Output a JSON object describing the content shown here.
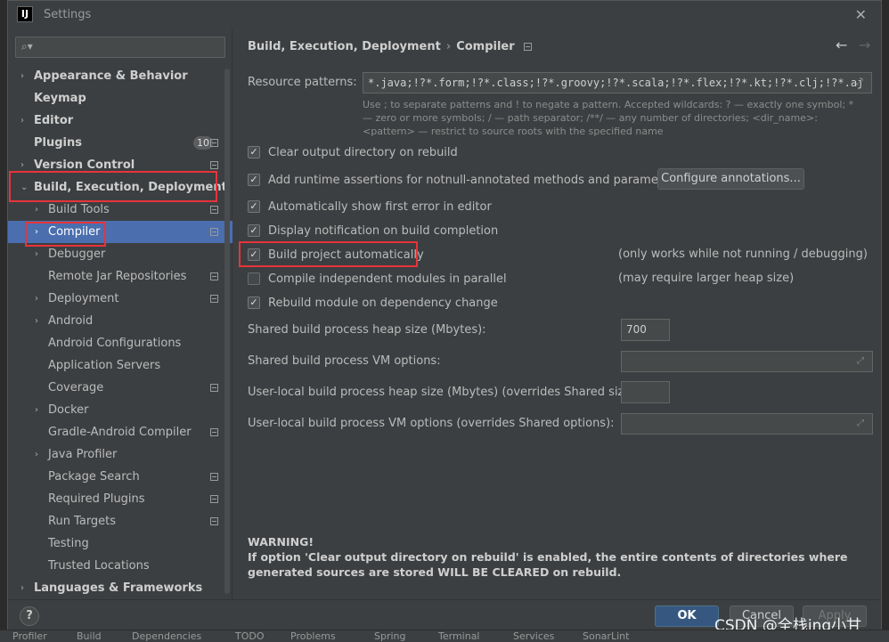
{
  "window": {
    "title": "Settings",
    "app_icon": "IJ"
  },
  "search": {
    "placeholder": ""
  },
  "sidebar": {
    "items": [
      {
        "label": "Appearance & Behavior",
        "arrow": "›",
        "bold": true,
        "badge": "",
        "proj": false,
        "sel": false,
        "level": 0
      },
      {
        "label": "Keymap",
        "arrow": "",
        "bold": true,
        "badge": "",
        "proj": false,
        "sel": false,
        "level": 0
      },
      {
        "label": "Editor",
        "arrow": "›",
        "bold": true,
        "badge": "",
        "proj": false,
        "sel": false,
        "level": 0
      },
      {
        "label": "Plugins",
        "arrow": "",
        "bold": true,
        "badge": "10",
        "proj": true,
        "sel": false,
        "level": 0
      },
      {
        "label": "Version Control",
        "arrow": "›",
        "bold": true,
        "badge": "",
        "proj": true,
        "sel": false,
        "level": 0
      },
      {
        "label": "Build, Execution, Deployment",
        "arrow": "⌄",
        "bold": true,
        "badge": "",
        "proj": false,
        "sel": false,
        "level": 0
      },
      {
        "label": "Build Tools",
        "arrow": "›",
        "bold": false,
        "badge": "",
        "proj": true,
        "sel": false,
        "level": 1
      },
      {
        "label": "Compiler",
        "arrow": "›",
        "bold": false,
        "badge": "",
        "proj": true,
        "sel": true,
        "level": 1
      },
      {
        "label": "Debugger",
        "arrow": "›",
        "bold": false,
        "badge": "",
        "proj": false,
        "sel": false,
        "level": 1
      },
      {
        "label": "Remote Jar Repositories",
        "arrow": "",
        "bold": false,
        "badge": "",
        "proj": true,
        "sel": false,
        "level": 1
      },
      {
        "label": "Deployment",
        "arrow": "›",
        "bold": false,
        "badge": "",
        "proj": true,
        "sel": false,
        "level": 1
      },
      {
        "label": "Android",
        "arrow": "›",
        "bold": false,
        "badge": "",
        "proj": false,
        "sel": false,
        "level": 1
      },
      {
        "label": "Android Configurations",
        "arrow": "",
        "bold": false,
        "badge": "",
        "proj": false,
        "sel": false,
        "level": 1
      },
      {
        "label": "Application Servers",
        "arrow": "",
        "bold": false,
        "badge": "",
        "proj": false,
        "sel": false,
        "level": 1
      },
      {
        "label": "Coverage",
        "arrow": "",
        "bold": false,
        "badge": "",
        "proj": true,
        "sel": false,
        "level": 1
      },
      {
        "label": "Docker",
        "arrow": "›",
        "bold": false,
        "badge": "",
        "proj": false,
        "sel": false,
        "level": 1
      },
      {
        "label": "Gradle-Android Compiler",
        "arrow": "",
        "bold": false,
        "badge": "",
        "proj": true,
        "sel": false,
        "level": 1
      },
      {
        "label": "Java Profiler",
        "arrow": "›",
        "bold": false,
        "badge": "",
        "proj": false,
        "sel": false,
        "level": 1
      },
      {
        "label": "Package Search",
        "arrow": "",
        "bold": false,
        "badge": "",
        "proj": true,
        "sel": false,
        "level": 1
      },
      {
        "label": "Required Plugins",
        "arrow": "",
        "bold": false,
        "badge": "",
        "proj": true,
        "sel": false,
        "level": 1
      },
      {
        "label": "Run Targets",
        "arrow": "",
        "bold": false,
        "badge": "",
        "proj": true,
        "sel": false,
        "level": 1
      },
      {
        "label": "Testing",
        "arrow": "",
        "bold": false,
        "badge": "",
        "proj": false,
        "sel": false,
        "level": 1
      },
      {
        "label": "Trusted Locations",
        "arrow": "",
        "bold": false,
        "badge": "",
        "proj": false,
        "sel": false,
        "level": 1
      },
      {
        "label": "Languages & Frameworks",
        "arrow": "›",
        "bold": true,
        "badge": "",
        "proj": false,
        "sel": false,
        "level": 0
      }
    ]
  },
  "breadcrumb": {
    "parent": "Build, Execution, Deployment",
    "sep": "›",
    "current": "Compiler"
  },
  "nav": {
    "back": "←",
    "forward": "→"
  },
  "resource": {
    "label": "Resource patterns:",
    "value": "*.java;!?*.form;!?*.class;!?*.groovy;!?*.scala;!?*.flex;!?*.kt;!?*.clj;!?*.aj",
    "hint": "Use ; to separate patterns and ! to negate a pattern. Accepted wildcards: ? — exactly one symbol; * — zero or more symbols; / — path separator; /**/ — any number of directories; <dir_name>:<pattern> — restrict to source roots with the specified name"
  },
  "checkboxes": [
    {
      "label": "Clear output directory on rebuild",
      "checked": true
    },
    {
      "label": "Add runtime assertions for notnull-annotated methods and parameters",
      "checked": true
    },
    {
      "label": "Automatically show first error in editor",
      "checked": true
    },
    {
      "label": "Display notification on build completion",
      "checked": true
    },
    {
      "label": "Build project automatically",
      "checked": true
    },
    {
      "label": "Compile independent modules in parallel",
      "checked": false
    },
    {
      "label": "Rebuild module on dependency change",
      "checked": true
    }
  ],
  "configure_btn": "Configure annotations...",
  "notes": {
    "build_auto": "(only works while not running / debugging)",
    "parallel": "(may require larger heap size)"
  },
  "fields": {
    "heap_label": "Shared build process heap size (Mbytes):",
    "heap_value": "700",
    "vm_label": "Shared build process VM options:",
    "user_heap_label": "User-local build process heap size (Mbytes) (overrides Shared size):",
    "user_vm_label": "User-local build process VM options (overrides Shared options):"
  },
  "warning": {
    "title": "WARNING!",
    "text": "If option 'Clear output directory on rebuild' is enabled, the entire contents of directories where generated sources are stored WILL BE CLEARED on rebuild."
  },
  "footer": {
    "help": "?",
    "ok": "OK",
    "cancel": "Cancel",
    "apply": "Apply"
  },
  "watermark": "CSDN @全栈ing小甘",
  "bottom_tabs": [
    "Profiler",
    "Build",
    "Dependencies",
    "TODO",
    "Problems",
    "Spring",
    "Terminal",
    "Services",
    "SonarLint"
  ],
  "colors": {
    "selection": "#4b6eaf",
    "annotation": "#e8333b",
    "ok_button": "#365880"
  }
}
